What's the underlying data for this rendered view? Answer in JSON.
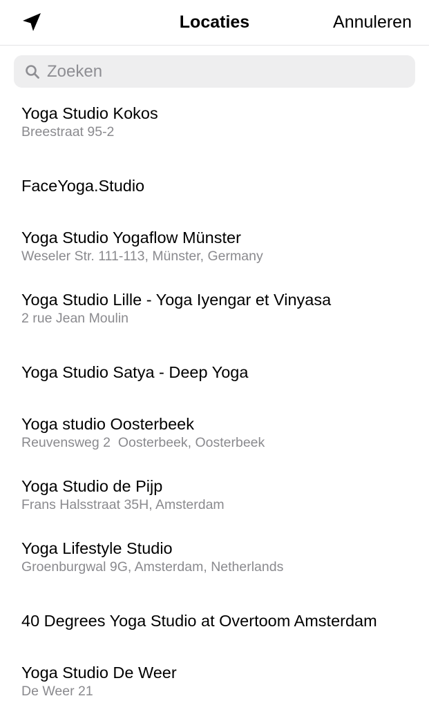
{
  "header": {
    "title": "Locaties",
    "cancel_label": "Annuleren",
    "location_icon": "location-arrow-icon"
  },
  "search": {
    "placeholder": "Zoeken",
    "value": "",
    "icon": "search-icon"
  },
  "results": [
    {
      "name": "Yoga Studio Kokos",
      "address": "Breestraat 95-2"
    },
    {
      "name": "FaceYoga.Studio",
      "address": ""
    },
    {
      "name": "Yoga Studio Yogaflow Münster",
      "address": "Weseler Str. 111-113, Münster, Germany"
    },
    {
      "name": "Yoga Studio Lille - Yoga Iyengar et Vinyasa",
      "address": "2 rue Jean Moulin"
    },
    {
      "name": "Yoga Studio Satya - Deep Yoga",
      "address": ""
    },
    {
      "name": "Yoga studio Oosterbeek",
      "address": "Reuvensweg 2  Oosterbeek, Oosterbeek"
    },
    {
      "name": "Yoga Studio de Pijp",
      "address": "Frans Halsstraat 35H, Amsterdam"
    },
    {
      "name": "Yoga Lifestyle Studio",
      "address": "Groenburgwal 9G, Amsterdam, Netherlands"
    },
    {
      "name": "40 Degrees Yoga Studio at Overtoom Amsterdam",
      "address": ""
    },
    {
      "name": "Yoga Studio De Weer",
      "address": "De Weer 21"
    }
  ]
}
